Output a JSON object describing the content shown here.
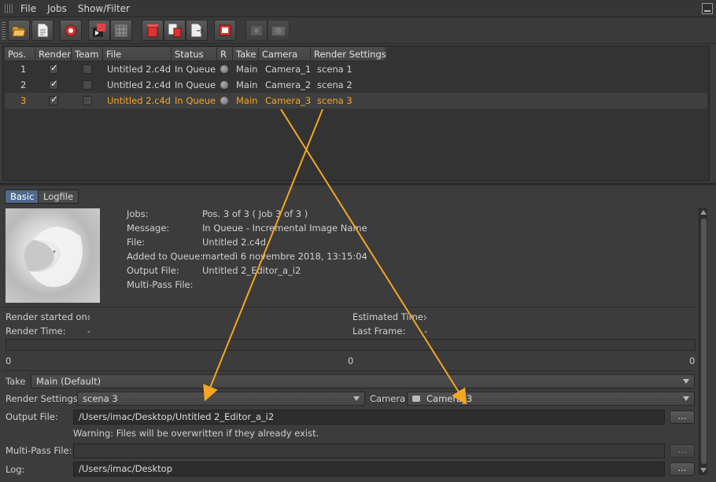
{
  "menu": [
    "File",
    "Jobs",
    "Show/Filter"
  ],
  "toolbar": {
    "buttons": [
      {
        "icon": "open-folder-icon"
      },
      {
        "icon": "new-document-icon"
      },
      {
        "icon": "render-icon"
      },
      {
        "icon": "render-queue-icon"
      },
      {
        "icon": "grid-icon"
      },
      {
        "icon": "delete-icon"
      },
      {
        "icon": "delete-all-icon"
      },
      {
        "icon": "export-icon"
      },
      {
        "icon": "stop-icon"
      },
      {
        "icon": "settings-dim-icon"
      },
      {
        "icon": "camera-dim-icon"
      }
    ]
  },
  "table": {
    "headers": [
      "Pos.",
      "Render",
      "Team",
      "File",
      "Status",
      "R",
      "Take",
      "Camera",
      "Render Settings"
    ],
    "rows": [
      {
        "pos": "1",
        "render": true,
        "team": false,
        "file": "Untitled 2.c4d",
        "status": "In Queue",
        "take": "Main",
        "camera": "Camera_1",
        "settings": "scena 1",
        "selected": false
      },
      {
        "pos": "2",
        "render": true,
        "team": false,
        "file": "Untitled 2.c4d",
        "status": "In Queue",
        "take": "Main",
        "camera": "Camera_2",
        "settings": "scena 2",
        "selected": false
      },
      {
        "pos": "3",
        "render": true,
        "team": false,
        "file": "Untitled 2.c4d",
        "status": "In Queue",
        "take": "Main",
        "camera": "Camera_3",
        "settings": "scena 3",
        "selected": true
      }
    ]
  },
  "tabs": {
    "basic": "Basic",
    "logfile": "Logfile"
  },
  "info": {
    "jobs_label": "Jobs:",
    "jobs_value": "Pos. 3 of 3 ( Job 3 of 3 )",
    "message_label": "Message:",
    "message_value": "In Queue - Incremental Image Name",
    "file_label": "File:",
    "file_value": "Untitled 2.c4d",
    "added_label": "Added to Queue:",
    "added_value": "martedì 6 novembre 2018, 13:15:04",
    "output_label": "Output File:",
    "output_value": "Untitled 2_Editor_a_i2",
    "multipass_label": "Multi-Pass File:"
  },
  "stats": {
    "started_label": "Render started on:",
    "started_value": "-",
    "time_label": "Render Time:",
    "time_value": "-",
    "estimated_label": "Estimated Time:",
    "estimated_value": "-",
    "lastframe_label": "Last Frame:",
    "lastframe_value": "-"
  },
  "progress": {
    "left": "0",
    "mid": "0",
    "right": "0",
    "fraction": 0
  },
  "settings": {
    "take_label": "Take",
    "take_value": "Main (Default)",
    "render_settings_label": "Render Settings",
    "render_settings_value": "scena 3",
    "camera_label": "Camera",
    "camera_value": "Camera_3",
    "output_label": "Output File:",
    "output_value": "/Users/imac/Desktop/Untitled 2_Editor_a_i2",
    "warning": "Warning: Files will be overwritten if they already exist.",
    "multipass_label": "Multi-Pass File:",
    "multipass_value": "",
    "log_label": "Log:",
    "log_value": "/Users/imac/Desktop",
    "browse": "..."
  },
  "colors": {
    "accent": "#f5a623",
    "tab_active": "#4e6a8c"
  }
}
